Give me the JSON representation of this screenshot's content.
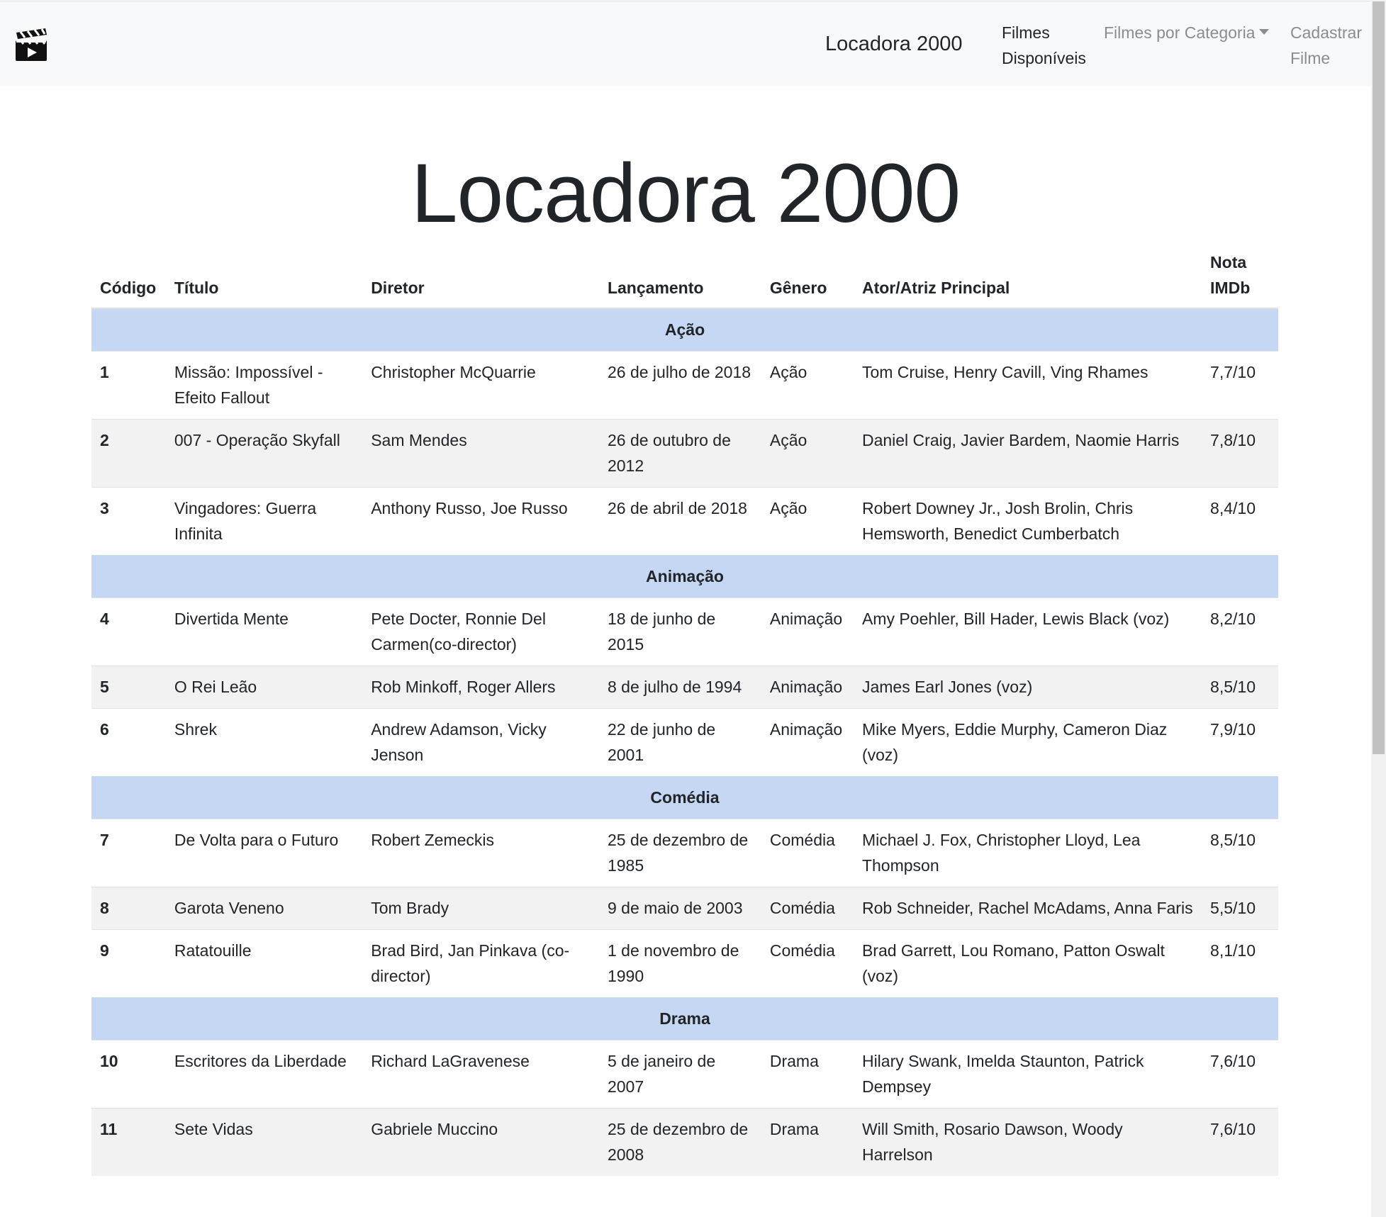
{
  "navbar": {
    "brand": "Locadora 2000",
    "links": [
      {
        "label": "Filmes Disponíveis",
        "active": true
      },
      {
        "label": "Filmes por Categoria",
        "dropdown": true
      },
      {
        "label": "Cadastrar Filme"
      }
    ]
  },
  "page_title": "Locadora 2000",
  "table": {
    "headers": [
      "Código",
      "Título",
      "Diretor",
      "Lançamento",
      "Gênero",
      "Ator/Atriz Principal",
      "Nota IMDb"
    ],
    "groups": [
      {
        "category": "Ação",
        "films": [
          {
            "code": "1",
            "title": "Missão: Impossível - Efeito Fallout",
            "director": "Christopher McQuarrie",
            "release": "26 de julho de 2018",
            "genre": "Ação",
            "cast": "Tom Cruise, Henry Cavill, Ving Rhames",
            "rating": "7,7/10"
          },
          {
            "code": "2",
            "title": "007 - Operação Skyfall",
            "director": "Sam Mendes",
            "release": "26 de outubro de 2012",
            "genre": "Ação",
            "cast": "Daniel Craig, Javier Bardem, Naomie Harris",
            "rating": "7,8/10"
          },
          {
            "code": "3",
            "title": "Vingadores: Guerra Infinita",
            "director": "Anthony Russo, Joe Russo",
            "release": "26 de abril de 2018",
            "genre": "Ação",
            "cast": "Robert Downey Jr., Josh Brolin, Chris Hemsworth, Benedict Cumberbatch",
            "rating": "8,4/10"
          }
        ]
      },
      {
        "category": "Animação",
        "films": [
          {
            "code": "4",
            "title": "Divertida Mente",
            "director": "Pete Docter, Ronnie Del Carmen(co-director)",
            "release": "18 de junho de 2015",
            "genre": "Animação",
            "cast": "Amy Poehler, Bill Hader, Lewis Black (voz)",
            "rating": "8,2/10"
          },
          {
            "code": "5",
            "title": "O Rei Leão",
            "director": "Rob Minkoff, Roger Allers",
            "release": "8 de julho de 1994",
            "genre": "Animação",
            "cast": "James Earl Jones (voz)",
            "rating": "8,5/10"
          },
          {
            "code": "6",
            "title": "Shrek",
            "director": "Andrew Adamson, Vicky Jenson",
            "release": "22 de junho de 2001",
            "genre": "Animação",
            "cast": "Mike Myers, Eddie Murphy, Cameron Diaz (voz)",
            "rating": "7,9/10"
          }
        ]
      },
      {
        "category": "Comédia",
        "films": [
          {
            "code": "7",
            "title": "De Volta para o Futuro",
            "director": "Robert Zemeckis",
            "release": "25 de dezembro de 1985",
            "genre": "Comédia",
            "cast": "Michael J. Fox, Christopher Lloyd, Lea Thompson",
            "rating": "8,5/10"
          },
          {
            "code": "8",
            "title": "Garota Veneno",
            "director": "Tom Brady",
            "release": "9 de maio de 2003",
            "genre": "Comédia",
            "cast": "Rob Schneider, Rachel McAdams, Anna Faris",
            "rating": "5,5/10"
          },
          {
            "code": "9",
            "title": "Ratatouille",
            "director": "Brad Bird, Jan Pinkava (co-director)",
            "release": "1 de novembro de 1990",
            "genre": "Comédia",
            "cast": "Brad Garrett, Lou Romano, Patton Oswalt (voz)",
            "rating": "8,1/10"
          }
        ]
      },
      {
        "category": "Drama",
        "films": [
          {
            "code": "10",
            "title": "Escritores da Liberdade",
            "director": "Richard LaGravenese",
            "release": "5 de janeiro de 2007",
            "genre": "Drama",
            "cast": "Hilary Swank, Imelda Staunton, Patrick Dempsey",
            "rating": "7,6/10"
          },
          {
            "code": "11",
            "title": "Sete Vidas",
            "director": "Gabriele Muccino",
            "release": "25 de dezembro de 2008",
            "genre": "Drama",
            "cast": "Will Smith, Rosario Dawson, Woody Harrelson",
            "rating": "7,6/10"
          }
        ]
      }
    ]
  },
  "colors": {
    "navbar_bg": "#f8f9fa",
    "category_row_bg": "#c6d7f3",
    "striped_row_bg": "#f2f2f2",
    "nav_muted_text": "#8a8d90"
  }
}
